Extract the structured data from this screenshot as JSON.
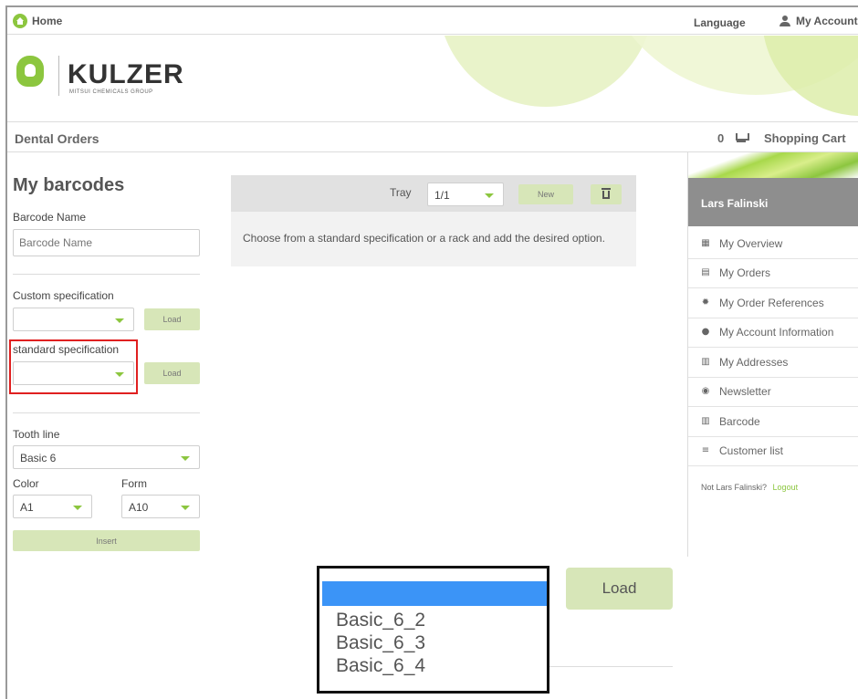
{
  "topbar": {
    "home_label": "Home",
    "language_label": "Language",
    "account_label": "My Account"
  },
  "brand": {
    "name": "KULZER",
    "tagline": "MITSUI CHEMICALS GROUP",
    "accent_color": "#8cc63f"
  },
  "subheader": {
    "title": "Dental Orders",
    "cart_count": "0",
    "cart_label": "Shopping Cart"
  },
  "barcodes": {
    "title": "My barcodes",
    "barcode_name_label": "Barcode Name",
    "barcode_name_placeholder": "Barcode Name",
    "barcode_name_value": "",
    "custom_spec_label": "Custom specification",
    "custom_spec_value": "",
    "custom_load_label": "Load",
    "standard_spec_label": "standard specification",
    "standard_spec_value": "",
    "standard_load_label": "Load",
    "tooth_line_label": "Tooth line",
    "tooth_line_value": "Basic 6",
    "color_label": "Color",
    "color_value": "A1",
    "form_label": "Form",
    "form_value": "A10",
    "insert_label": "Insert"
  },
  "tray": {
    "label": "Tray",
    "value": "1/1",
    "new_label": "New",
    "message": "Choose from a standard specification or a rack and add the desired option."
  },
  "sidebar": {
    "user_name": "Lars Falinski",
    "items": [
      {
        "label": "My Overview",
        "icon": "grid-icon"
      },
      {
        "label": "My Orders",
        "icon": "document-icon"
      },
      {
        "label": "My Order References",
        "icon": "gear-icon"
      },
      {
        "label": "My Account Information",
        "icon": "user-icon"
      },
      {
        "label": "My Addresses",
        "icon": "building-icon"
      },
      {
        "label": "Newsletter",
        "icon": "info-icon"
      },
      {
        "label": "Barcode",
        "icon": "barcode-icon"
      },
      {
        "label": "Customer list",
        "icon": "list-icon"
      }
    ],
    "not_user_text": "Not Lars Falinski?",
    "logout_label": "Logout"
  },
  "dropdown_zoom": {
    "options": [
      "Basic_6_2",
      "Basic_6_3",
      "Basic_6_4"
    ],
    "load_label": "Load",
    "selected_color": "#3b94f7"
  }
}
